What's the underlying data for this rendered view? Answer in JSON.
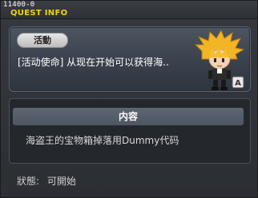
{
  "window": {
    "quest_id": "11400-0",
    "title": "QUEST INFO"
  },
  "top_panel": {
    "tag_label": "活動",
    "summary": "[活动使命] 从现在开始可以获得海.."
  },
  "npc_badge": "A",
  "content": {
    "header": "内容",
    "text": "海盗王的宝物箱掉落用Dummy代码"
  },
  "status": {
    "label": "狀態:",
    "value": "可開始"
  },
  "colors": {
    "title": "#f2d21a",
    "panel_top": "#3d4450",
    "panel_bottom": "#24272c",
    "content_header": "#5d6672"
  }
}
